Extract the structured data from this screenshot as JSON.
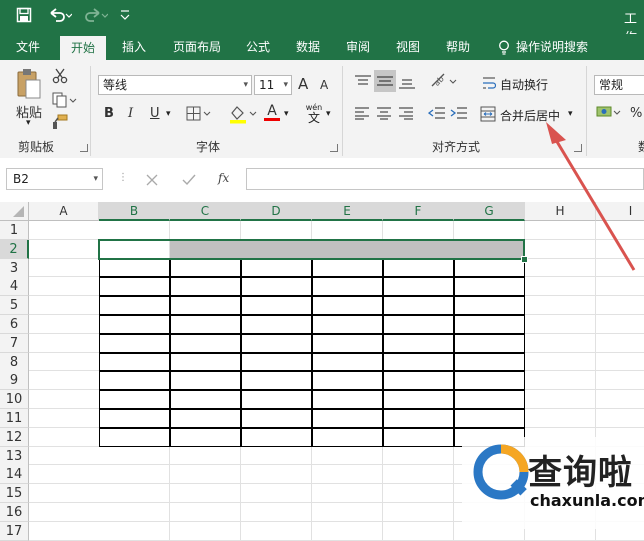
{
  "title_bar": {
    "title": "工作"
  },
  "tabs": [
    "文件",
    "开始",
    "插入",
    "页面布局",
    "公式",
    "数据",
    "审阅",
    "视图",
    "帮助"
  ],
  "tell_me": "操作说明搜索",
  "ribbon": {
    "clipboard": {
      "paste": "粘贴",
      "group": "剪贴板"
    },
    "font": {
      "name": "等线",
      "size": "11",
      "bold": "B",
      "italic": "I",
      "underline": "U",
      "grow": "A",
      "shrink": "A",
      "phonetic_top": "wén",
      "phonetic_char": "文",
      "group": "字体"
    },
    "alignment": {
      "wrap": "自动换行",
      "merge": "合并后居中",
      "group": "对齐方式"
    },
    "number": {
      "format": "常规",
      "percent": "%",
      "group": "数"
    }
  },
  "formula_bar": {
    "name_box": "B2",
    "fx": "fx"
  },
  "columns": [
    "A",
    "B",
    "C",
    "D",
    "E",
    "F",
    "G",
    "H",
    "I"
  ],
  "rows": [
    "1",
    "2",
    "3",
    "4",
    "5",
    "6",
    "7",
    "8",
    "9",
    "10",
    "11",
    "12",
    "13",
    "14",
    "15",
    "16",
    "17"
  ],
  "watermark": {
    "brand": "查询啦",
    "url": "chaxunla.com"
  },
  "colors": {
    "accent": "#217346",
    "arrow": "#d9534f",
    "selection": "#c0c0c0"
  }
}
